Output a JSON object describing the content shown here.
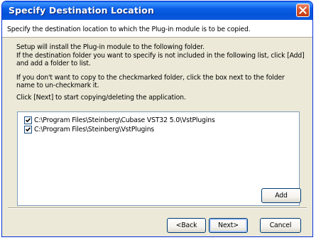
{
  "window": {
    "title": "Specify Destination Location"
  },
  "header": {
    "text": "Specify the destination location to which the Plug-in module is to be copied."
  },
  "body": {
    "line1": "Setup will install the Plug-in module to the following folder.",
    "line2": "If the destination folder you want to specify is not included in the following list, click [Add] and add a folder to list.",
    "line3": "If you don't want to copy to the checkmarked folder, click the box next to the folder name to un-checkmark it.",
    "line4": "Click [Next] to start copying/deleting the application."
  },
  "folders": [
    {
      "path": "C:\\Program Files\\Steinberg\\Cubase VST32 5.0\\VstPlugins",
      "checked": true
    },
    {
      "path": "C:\\Program Files\\Steinberg\\VstPlugins",
      "checked": true
    }
  ],
  "buttons": {
    "add": "Add",
    "back": "<Back",
    "next": "Next>",
    "cancel": "Cancel"
  },
  "colors": {
    "titlebar": "#0a5ee6",
    "window_bg": "#ece9d8",
    "close_button": "#d8532b"
  }
}
